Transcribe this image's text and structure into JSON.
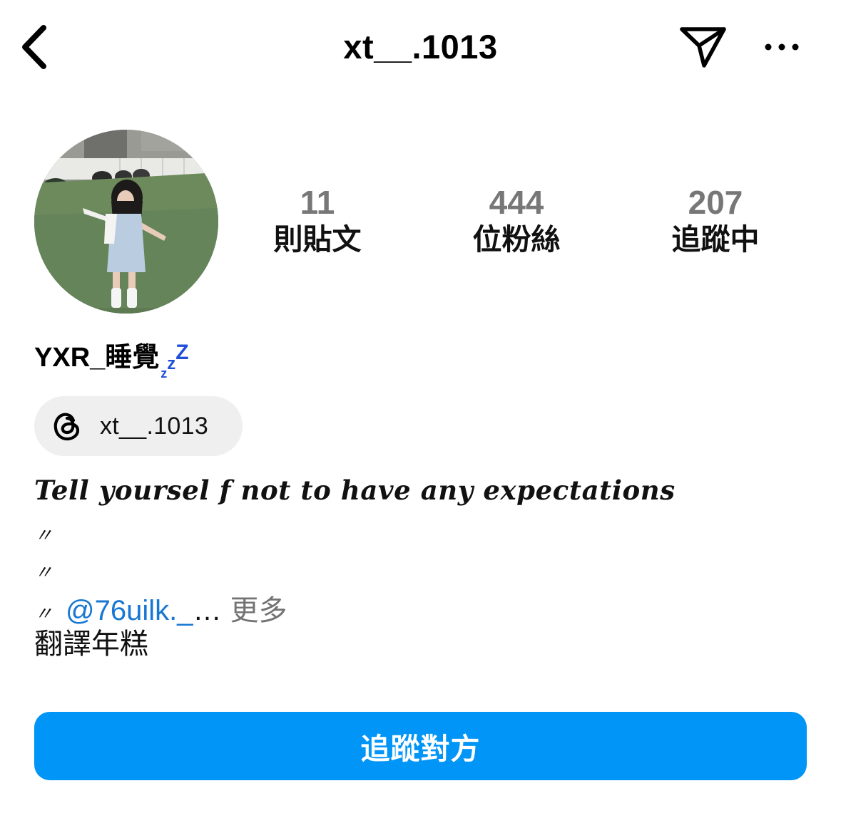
{
  "header": {
    "username": "xt__.1013",
    "back_icon": "chevron-left-icon",
    "send_icon": "paper-plane-icon",
    "more_icon": "more-horizontal-icon"
  },
  "profile": {
    "avatar_alt": "profile-photo",
    "display_name": "YXR_睡覺",
    "zzz": [
      "z",
      "z",
      "Z"
    ],
    "zzz_color": "#1f4fd8"
  },
  "stats": [
    {
      "number": "11",
      "label": "則貼文"
    },
    {
      "number": "444",
      "label": "位粉絲"
    },
    {
      "number": "207",
      "label": "追蹤中"
    }
  ],
  "threads": {
    "icon": "threads-icon",
    "handle": "xt__.1013"
  },
  "bio": {
    "quote": "Tell yoursel f  not to have any expectations",
    "line1": "〃",
    "line2": "〃",
    "line3_marks": "〃",
    "mention": "@76uilk._",
    "ellipsis": "…",
    "more": "更多",
    "translate": "翻譯年糕"
  },
  "actions": {
    "follow_label": "追蹤對方",
    "follow_color": "#0095f6"
  }
}
